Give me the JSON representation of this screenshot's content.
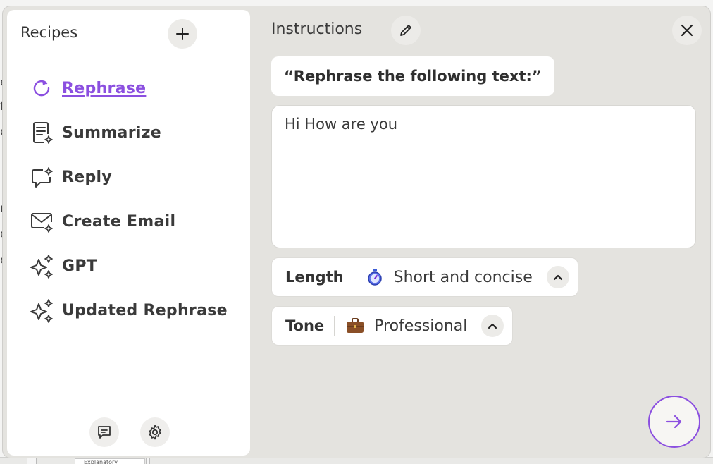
{
  "background": {
    "edge_letters": [
      "e",
      "fi",
      "c",
      "r",
      "o",
      "c"
    ],
    "bottom_chip": "Explanatory"
  },
  "sidebar": {
    "title": "Recipes",
    "add_icon": "plus-icon",
    "items": [
      {
        "label": "Rephrase",
        "icon": "refresh-sparkle-icon",
        "active": true
      },
      {
        "label": "Summarize",
        "icon": "document-sparkle-icon",
        "active": false
      },
      {
        "label": "Reply",
        "icon": "chat-sparkle-icon",
        "active": false
      },
      {
        "label": "Create Email",
        "icon": "mail-sparkle-icon",
        "active": false
      },
      {
        "label": "GPT",
        "icon": "sparkles-icon",
        "active": false
      },
      {
        "label": "Updated Rephrase",
        "icon": "sparkles-icon",
        "active": false
      }
    ],
    "footer": {
      "feedback_icon": "feedback-icon",
      "settings_icon": "gear-icon"
    }
  },
  "main": {
    "title": "Instructions",
    "edit_icon": "pencil-icon",
    "close_icon": "close-icon",
    "prompt": "“Rephrase the following text:”",
    "input_text": "Hi How are you",
    "options": [
      {
        "key": "Length",
        "value": "Short and concise",
        "icon": "stopwatch-icon"
      },
      {
        "key": "Tone",
        "value": "Professional",
        "icon": "briefcase-icon"
      }
    ],
    "send_icon": "arrow-right-icon"
  },
  "colors": {
    "accent": "#8b4fe0",
    "window_bg": "#e4e3df",
    "panel_bg": "#ffffff"
  }
}
